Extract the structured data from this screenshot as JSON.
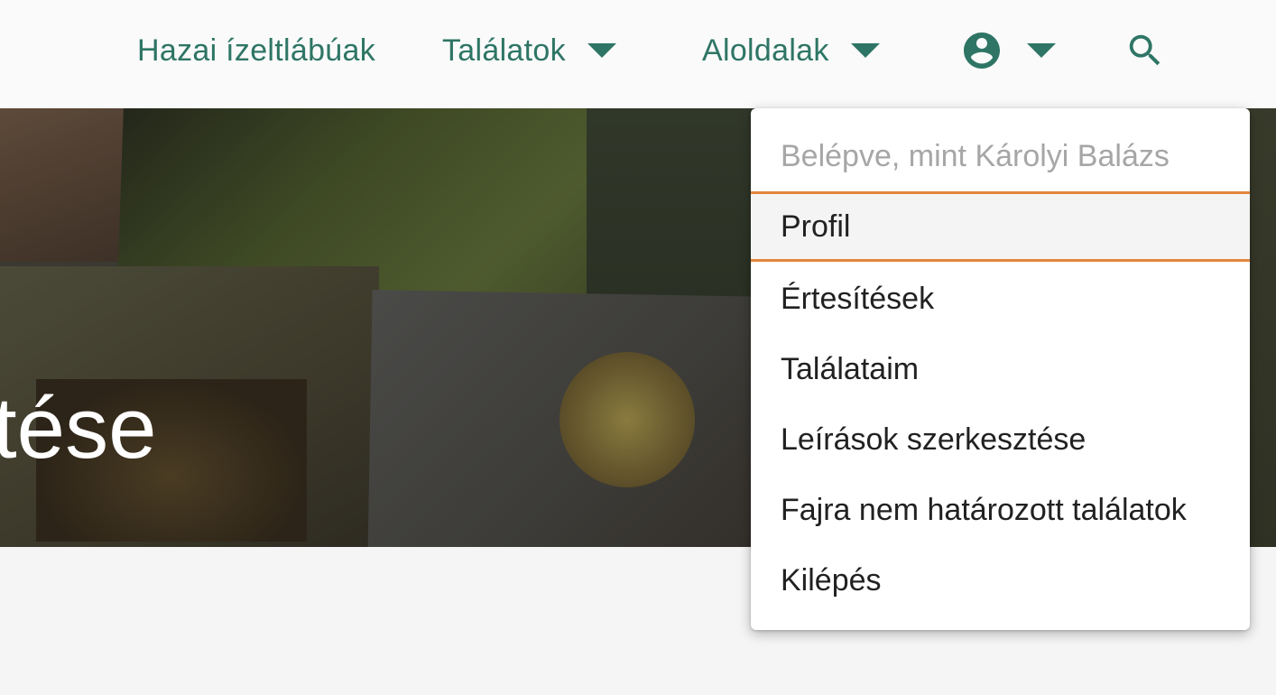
{
  "navbar": {
    "brand_label": "Hazai ízeltlábúak",
    "findings_label": "Találatok",
    "subpages_label": "Aloldalak",
    "account_icon": "account-circle-icon",
    "search_icon": "search-icon",
    "accent_color": "#2e7565"
  },
  "hero": {
    "title_fragment": "tése"
  },
  "user_menu": {
    "header": "Belépve, mint Károlyi Balázs",
    "highlight_color": "#e3863e",
    "items": [
      {
        "label": "Profil"
      },
      {
        "label": "Értesítések"
      },
      {
        "label": "Találataim"
      },
      {
        "label": "Leírások szerkesztése"
      },
      {
        "label": "Fajra nem határozott találatok"
      },
      {
        "label": "Kilépés"
      }
    ]
  }
}
